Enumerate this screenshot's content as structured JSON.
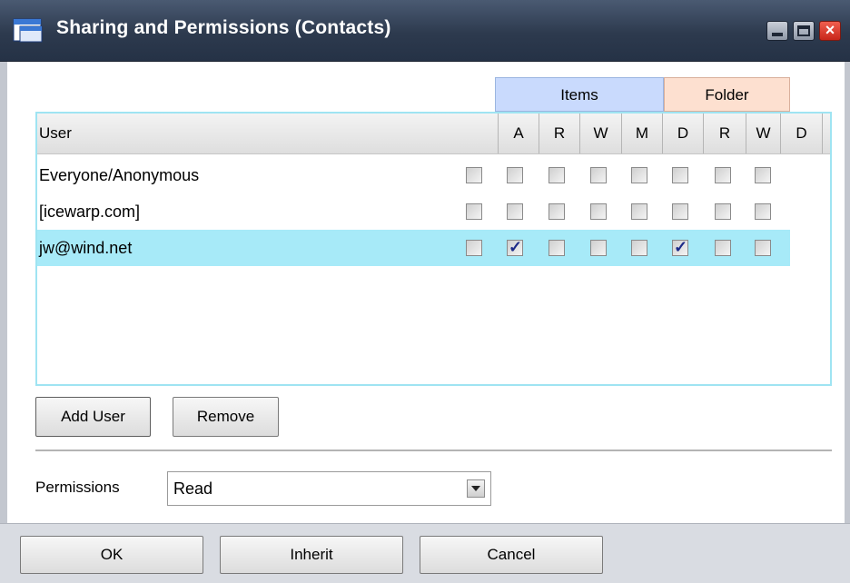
{
  "window": {
    "title": "Sharing and Permissions (Contacts)"
  },
  "groups": {
    "items": "Items",
    "folder": "Folder"
  },
  "columns": {
    "user": "User",
    "a": "A",
    "items_r": "R",
    "items_w": "W",
    "items_m": "M",
    "items_d": "D",
    "folder_r": "R",
    "folder_w": "W",
    "folder_d": "D"
  },
  "users": [
    {
      "name": "Everyone/Anonymous",
      "selected": false,
      "perms": {
        "a": false,
        "items_r": false,
        "items_w": false,
        "items_m": false,
        "items_d": false,
        "folder_r": false,
        "folder_w": false,
        "folder_d": false
      }
    },
    {
      "name": "[icewarp.com]",
      "selected": false,
      "perms": {
        "a": false,
        "items_r": false,
        "items_w": false,
        "items_m": false,
        "items_d": false,
        "folder_r": false,
        "folder_w": false,
        "folder_d": false
      }
    },
    {
      "name": "jw@wind.net",
      "selected": true,
      "perms": {
        "a": false,
        "items_r": true,
        "items_w": false,
        "items_m": false,
        "items_d": false,
        "folder_r": true,
        "folder_w": false,
        "folder_d": false
      }
    }
  ],
  "buttons": {
    "add_user": "Add User",
    "remove": "Remove",
    "ok": "OK",
    "inherit": "Inherit",
    "cancel": "Cancel"
  },
  "permissions": {
    "label": "Permissions",
    "value": "Read"
  },
  "icons": {
    "window": "window-icon",
    "minimize": "minimize-icon",
    "maximize": "maximize-icon",
    "close": "close-icon",
    "dropdown": "chevron-down-icon"
  },
  "colors": {
    "titlebar": "#2d3a4e",
    "items_group": "#c9dafd",
    "folder_group": "#fde0d0",
    "selected_row": "#a7eaf8",
    "list_border": "#9fe4f2"
  }
}
